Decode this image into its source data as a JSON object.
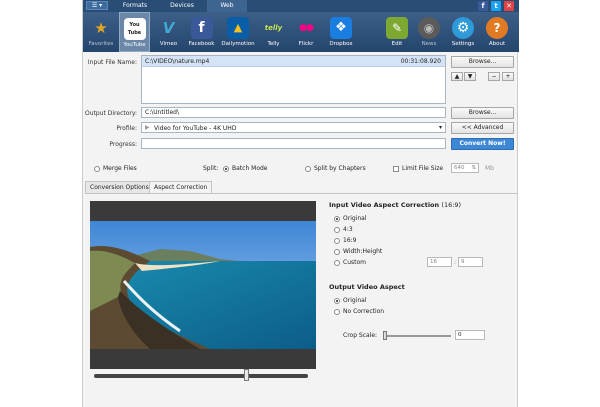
{
  "colors": {
    "titlebar": "#2a4d75",
    "toolbar": "#2f5079",
    "accent": "#3c87d6",
    "youtube": "#d9322e",
    "vimeo": "#3fa8d4",
    "facebook": "#3b5998",
    "dailymotion": "#0a5ea8",
    "flickr": "#ff0084",
    "dropbox": "#1a7ee0"
  },
  "tabs": {
    "app_menu": "☰ ▾",
    "formats": "Formats",
    "devices": "Devices",
    "web": "Web"
  },
  "window": {
    "facebook": "f",
    "twitter": "t",
    "close": "✕"
  },
  "toolbar": [
    {
      "name": "favorites",
      "label": "Favorites",
      "icon": "star-icon",
      "glyph": "★"
    },
    {
      "name": "youtube",
      "label": "YouTube",
      "icon": "youtube-icon",
      "glyph": "You Tube"
    },
    {
      "name": "vimeo",
      "label": "Vimeo",
      "icon": "vimeo-icon",
      "glyph": "V"
    },
    {
      "name": "facebook",
      "label": "Facebook",
      "icon": "facebook-icon",
      "glyph": "f"
    },
    {
      "name": "dailymotion",
      "label": "Dailymotion",
      "icon": "dailymotion-icon",
      "glyph": "▲"
    },
    {
      "name": "telly",
      "label": "Telly",
      "icon": "telly-icon",
      "glyph": "telly"
    },
    {
      "name": "flickr",
      "label": "Flickr",
      "icon": "flickr-icon",
      "glyph": "●●"
    },
    {
      "name": "dropbox",
      "label": "Dropbox",
      "icon": "dropbox-icon",
      "glyph": "❖"
    },
    {
      "name": "edit",
      "label": "Edit",
      "icon": "edit-icon",
      "glyph": "✎"
    },
    {
      "name": "news",
      "label": "News",
      "icon": "news-icon",
      "glyph": "◉"
    },
    {
      "name": "settings",
      "label": "Settings",
      "icon": "gear-icon",
      "glyph": "⚙"
    },
    {
      "name": "about",
      "label": "About",
      "icon": "about-icon",
      "glyph": "?"
    }
  ],
  "input": {
    "label": "Input File Name:",
    "file": "C:\\VIDEO\\nature.mp4",
    "duration": "00:31:08.920",
    "browse": "Browse...",
    "plus": "+",
    "minus": "−",
    "up": "▲",
    "down": "▼"
  },
  "output": {
    "label": "Output Directory:",
    "path": "C:\\Untitled\\",
    "browse": "Browse..."
  },
  "profile": {
    "label": "Profile:",
    "value": "Video for YouTube - 4K UHD",
    "advanced": "<< Advanced"
  },
  "progress": {
    "label": "Progress:",
    "convert": "Convert Now!"
  },
  "options": {
    "merge": "Merge Files",
    "split_label": "Split:",
    "batch": "Batch Mode",
    "split_chapters": "Split by Chapters",
    "limit": "Limit File Size",
    "limit_value": "640",
    "limit_unit": "Mb"
  },
  "gtabs": {
    "conversion": "Conversion Options",
    "aspect": "Aspect Correction"
  },
  "aspect": {
    "input_title": "Input Video Aspect Correction",
    "input_ratio": "(16:9)",
    "input_options": [
      "Original",
      "4:3",
      "16:9",
      "Width:Height",
      "Custom"
    ],
    "custom_w": "16",
    "custom_sep": ":",
    "custom_h": "9",
    "output_title": "Output Video Aspect",
    "output_options": [
      "Original",
      "No Correction"
    ],
    "crop_label": "Crop Scale:",
    "crop_value": "0"
  }
}
